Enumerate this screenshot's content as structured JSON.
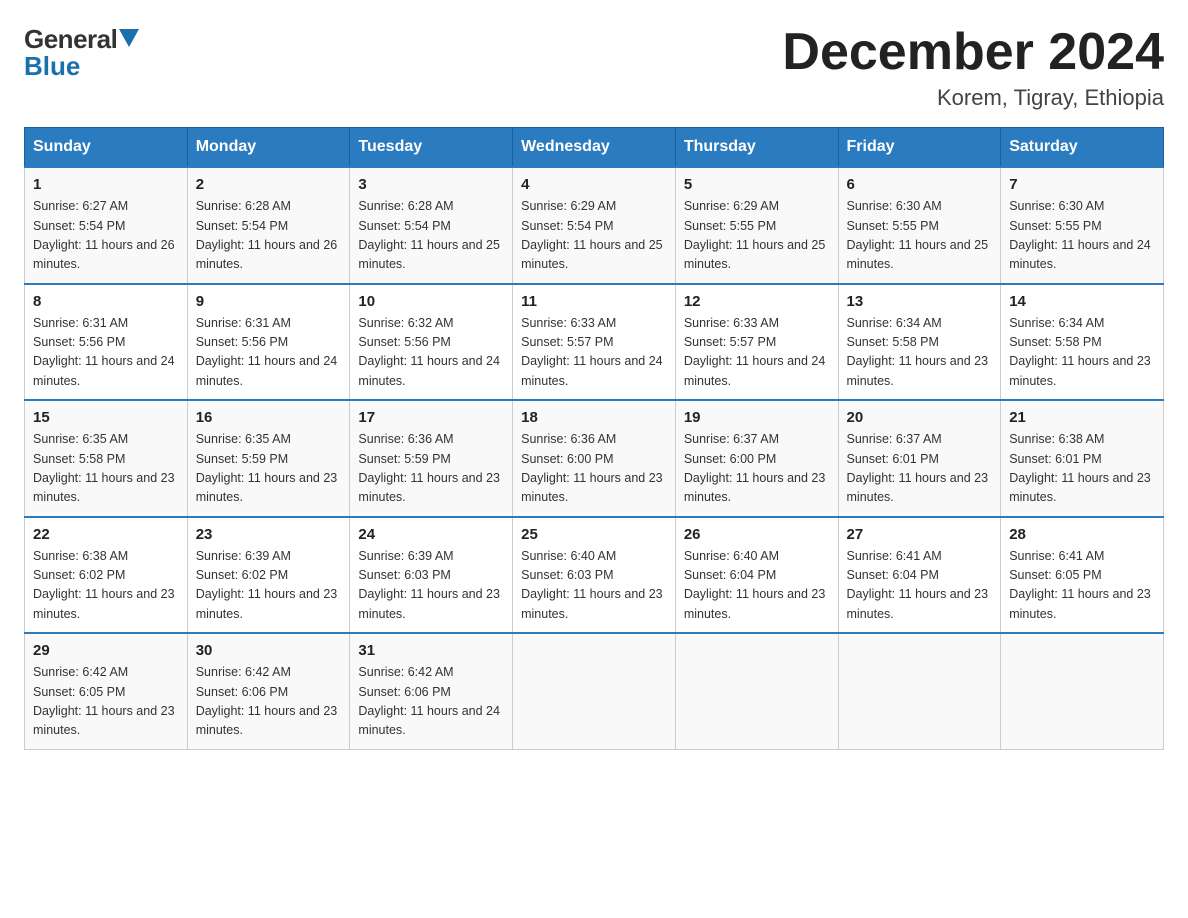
{
  "header": {
    "logo_general": "General",
    "logo_blue": "Blue",
    "month_title": "December 2024",
    "location": "Korem, Tigray, Ethiopia"
  },
  "days_of_week": [
    "Sunday",
    "Monday",
    "Tuesday",
    "Wednesday",
    "Thursday",
    "Friday",
    "Saturday"
  ],
  "weeks": [
    [
      {
        "day": "1",
        "sunrise": "6:27 AM",
        "sunset": "5:54 PM",
        "daylight": "11 hours and 26 minutes."
      },
      {
        "day": "2",
        "sunrise": "6:28 AM",
        "sunset": "5:54 PM",
        "daylight": "11 hours and 26 minutes."
      },
      {
        "day": "3",
        "sunrise": "6:28 AM",
        "sunset": "5:54 PM",
        "daylight": "11 hours and 25 minutes."
      },
      {
        "day": "4",
        "sunrise": "6:29 AM",
        "sunset": "5:54 PM",
        "daylight": "11 hours and 25 minutes."
      },
      {
        "day": "5",
        "sunrise": "6:29 AM",
        "sunset": "5:55 PM",
        "daylight": "11 hours and 25 minutes."
      },
      {
        "day": "6",
        "sunrise": "6:30 AM",
        "sunset": "5:55 PM",
        "daylight": "11 hours and 25 minutes."
      },
      {
        "day": "7",
        "sunrise": "6:30 AM",
        "sunset": "5:55 PM",
        "daylight": "11 hours and 24 minutes."
      }
    ],
    [
      {
        "day": "8",
        "sunrise": "6:31 AM",
        "sunset": "5:56 PM",
        "daylight": "11 hours and 24 minutes."
      },
      {
        "day": "9",
        "sunrise": "6:31 AM",
        "sunset": "5:56 PM",
        "daylight": "11 hours and 24 minutes."
      },
      {
        "day": "10",
        "sunrise": "6:32 AM",
        "sunset": "5:56 PM",
        "daylight": "11 hours and 24 minutes."
      },
      {
        "day": "11",
        "sunrise": "6:33 AM",
        "sunset": "5:57 PM",
        "daylight": "11 hours and 24 minutes."
      },
      {
        "day": "12",
        "sunrise": "6:33 AM",
        "sunset": "5:57 PM",
        "daylight": "11 hours and 24 minutes."
      },
      {
        "day": "13",
        "sunrise": "6:34 AM",
        "sunset": "5:58 PM",
        "daylight": "11 hours and 23 minutes."
      },
      {
        "day": "14",
        "sunrise": "6:34 AM",
        "sunset": "5:58 PM",
        "daylight": "11 hours and 23 minutes."
      }
    ],
    [
      {
        "day": "15",
        "sunrise": "6:35 AM",
        "sunset": "5:58 PM",
        "daylight": "11 hours and 23 minutes."
      },
      {
        "day": "16",
        "sunrise": "6:35 AM",
        "sunset": "5:59 PM",
        "daylight": "11 hours and 23 minutes."
      },
      {
        "day": "17",
        "sunrise": "6:36 AM",
        "sunset": "5:59 PM",
        "daylight": "11 hours and 23 minutes."
      },
      {
        "day": "18",
        "sunrise": "6:36 AM",
        "sunset": "6:00 PM",
        "daylight": "11 hours and 23 minutes."
      },
      {
        "day": "19",
        "sunrise": "6:37 AM",
        "sunset": "6:00 PM",
        "daylight": "11 hours and 23 minutes."
      },
      {
        "day": "20",
        "sunrise": "6:37 AM",
        "sunset": "6:01 PM",
        "daylight": "11 hours and 23 minutes."
      },
      {
        "day": "21",
        "sunrise": "6:38 AM",
        "sunset": "6:01 PM",
        "daylight": "11 hours and 23 minutes."
      }
    ],
    [
      {
        "day": "22",
        "sunrise": "6:38 AM",
        "sunset": "6:02 PM",
        "daylight": "11 hours and 23 minutes."
      },
      {
        "day": "23",
        "sunrise": "6:39 AM",
        "sunset": "6:02 PM",
        "daylight": "11 hours and 23 minutes."
      },
      {
        "day": "24",
        "sunrise": "6:39 AM",
        "sunset": "6:03 PM",
        "daylight": "11 hours and 23 minutes."
      },
      {
        "day": "25",
        "sunrise": "6:40 AM",
        "sunset": "6:03 PM",
        "daylight": "11 hours and 23 minutes."
      },
      {
        "day": "26",
        "sunrise": "6:40 AM",
        "sunset": "6:04 PM",
        "daylight": "11 hours and 23 minutes."
      },
      {
        "day": "27",
        "sunrise": "6:41 AM",
        "sunset": "6:04 PM",
        "daylight": "11 hours and 23 minutes."
      },
      {
        "day": "28",
        "sunrise": "6:41 AM",
        "sunset": "6:05 PM",
        "daylight": "11 hours and 23 minutes."
      }
    ],
    [
      {
        "day": "29",
        "sunrise": "6:42 AM",
        "sunset": "6:05 PM",
        "daylight": "11 hours and 23 minutes."
      },
      {
        "day": "30",
        "sunrise": "6:42 AM",
        "sunset": "6:06 PM",
        "daylight": "11 hours and 23 minutes."
      },
      {
        "day": "31",
        "sunrise": "6:42 AM",
        "sunset": "6:06 PM",
        "daylight": "11 hours and 24 minutes."
      },
      null,
      null,
      null,
      null
    ]
  ]
}
